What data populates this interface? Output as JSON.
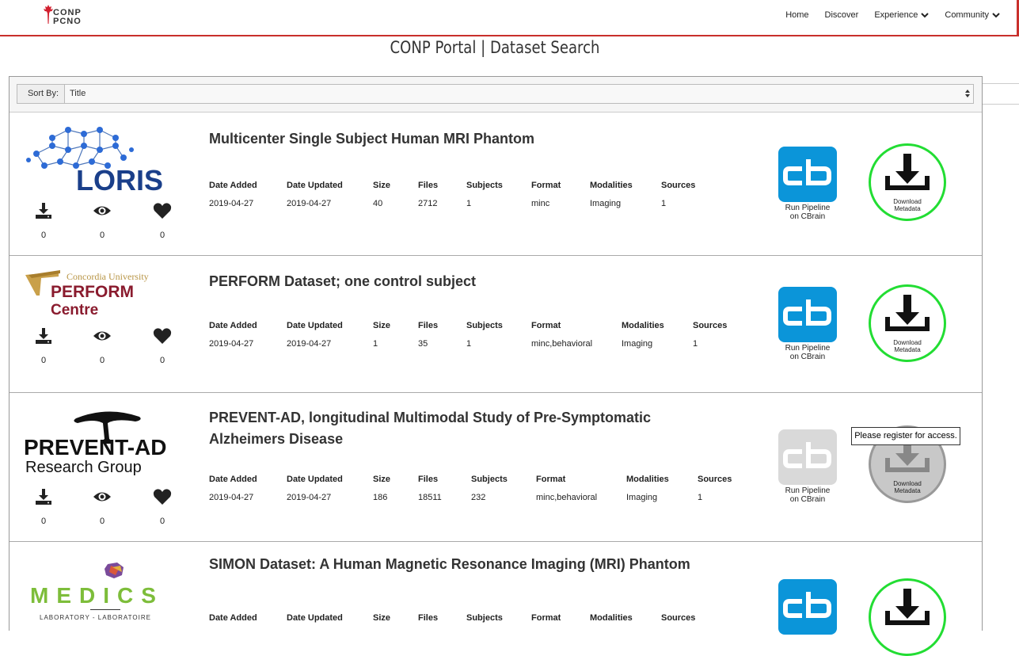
{
  "brand": {
    "line1": "CONP",
    "line2": "PCNO"
  },
  "nav": {
    "home": "Home",
    "discover": "Discover",
    "experience": "Experience",
    "community": "Community"
  },
  "page_title": "CONP Portal | Dataset Search",
  "sort": {
    "label": "Sort By:",
    "value": "Title"
  },
  "headers": {
    "date_added": "Date Added",
    "date_updated": "Date Updated",
    "size": "Size",
    "files": "Files",
    "subjects": "Subjects",
    "format": "Format",
    "modalities": "Modalities",
    "sources": "Sources"
  },
  "cbrain": {
    "line1": "Run Pipeline",
    "line2": "on CBrain"
  },
  "download_meta": {
    "line1": "Download",
    "line2": "Metadata"
  },
  "tooltip": "Please register for access.",
  "datasets": [
    {
      "logo_text": "LORIS",
      "title": "Multicenter Single Subject Human MRI Phantom",
      "date_added": "2019-04-27",
      "date_updated": "2019-04-27",
      "size": "40",
      "files": "2712",
      "subjects": "1",
      "format": "minc",
      "modalities": "Imaging",
      "sources": "1",
      "downloads": "0",
      "views": "0",
      "likes": "0"
    },
    {
      "logo_text1": "Concordia University",
      "logo_text2": "PERFORM",
      "logo_text3": "Centre",
      "title": "PERFORM Dataset; one control subject",
      "date_added": "2019-04-27",
      "date_updated": "2019-04-27",
      "size": "1",
      "files": "35",
      "subjects": "1",
      "format": "minc,behavioral",
      "modalities": "Imaging",
      "sources": "1",
      "downloads": "0",
      "views": "0",
      "likes": "0"
    },
    {
      "logo_text1": "PREVENT-AD",
      "logo_text2": "Research Group",
      "title_line1": "PREVENT-AD, longitudinal Multimodal Study of Pre-Symptomatic",
      "title_line2": "Alzheimers Disease",
      "date_added": "2019-04-27",
      "date_updated": "2019-04-27",
      "size": "186",
      "files": "18511",
      "subjects": "232",
      "format": "minc,behavioral",
      "modalities": "Imaging",
      "sources": "1",
      "downloads": "0",
      "views": "0",
      "likes": "0"
    },
    {
      "logo_text1": "MEDICS",
      "logo_text2": "LABORATORY - LABORATOIRE",
      "title": "SIMON Dataset: A Human Magnetic Resonance Imaging (MRI) Phantom"
    }
  ],
  "colors": {
    "accent_red": "#c9302c",
    "cbrain_blue": "#0b95d9",
    "download_green": "#22dd33",
    "disabled_grey": "#d9d9d9"
  }
}
